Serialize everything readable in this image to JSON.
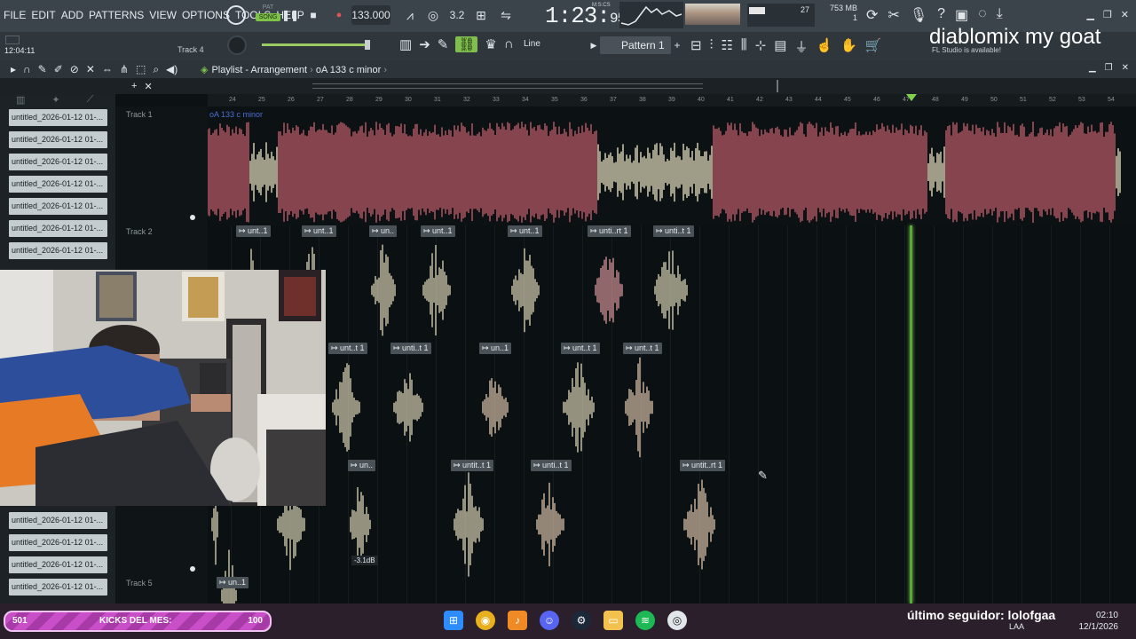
{
  "menu": [
    "FILE",
    "EDIT",
    "ADD",
    "PATTERNS",
    "VIEW",
    "OPTIONS",
    "TOOLS",
    "HELP"
  ],
  "transport": {
    "pat_label": "PAT",
    "song_label": "SONG",
    "tempo": "133.000",
    "time_main": "1:23",
    "time_sub": "95",
    "time_unit": "M:S:CS",
    "cpu_value": "27",
    "memory": "753 MB",
    "voices": "1"
  },
  "toolbar": {
    "clock": "12:04:11",
    "track_hint": "Track 4",
    "snap": "Line",
    "pattern": "Pattern 1",
    "update_note": "FL Studio is available!",
    "overlay_text": "diablomix my goat"
  },
  "playlist": {
    "title": "Playlist - Arrangement",
    "arrangement": "oA 133 c minor",
    "ruler": [
      "24",
      "25",
      "26",
      "27",
      "28",
      "29",
      "30",
      "31",
      "32",
      "33",
      "34",
      "35",
      "36",
      "37",
      "38",
      "39",
      "40",
      "41",
      "42",
      "43",
      "44",
      "45",
      "46",
      "47",
      "48",
      "49",
      "50",
      "51",
      "52",
      "53",
      "54"
    ],
    "tracks": [
      "Track 1",
      "Track 2",
      "Track 5"
    ],
    "track1_clip": "oA 133 c minor",
    "clip_tags": [
      "unt..1",
      "unt..1",
      "un..",
      "unt..1",
      "unt..1",
      "unti..rt 1",
      "unti..t 1",
      "unt..t 1",
      "unti..t 1",
      "un..1",
      "unt..t 1",
      "unt..t 1",
      "un..",
      "untit..t 1",
      "unti..t 1",
      "untit..rt 1",
      "un..1"
    ],
    "db_label": "-3.1dB"
  },
  "browser": {
    "items": [
      "untitled_2026-01-12 01-...",
      "untitled_2026-01-12 01-...",
      "untitled_2026-01-12 01-...",
      "untitled_2026-01-12 01-...",
      "untitled_2026-01-12 01-...",
      "untitled_2026-01-12 01-...",
      "untitled_2026-01-12 01-...",
      "untitled_2026-01-12 01-...",
      "untitled_2026-01-12 01-...",
      "untitled_2026-01-12 01-...",
      "untitled_2026-01-12 01-..."
    ]
  },
  "taskbar": {
    "kicks_left": "501",
    "kicks_label": "KICKS DEL MES:",
    "kicks_right": "100",
    "follower": "último seguidor: lolofgaa",
    "tray_lang": "LAA",
    "tray_time": "02:10",
    "tray_date": "12/1/2026"
  },
  "colors": {
    "clip_red": "#c9626f",
    "clip_cream": "#efe9c6",
    "playhead": "#58a93a",
    "accent_green": "#7fbf4d"
  }
}
